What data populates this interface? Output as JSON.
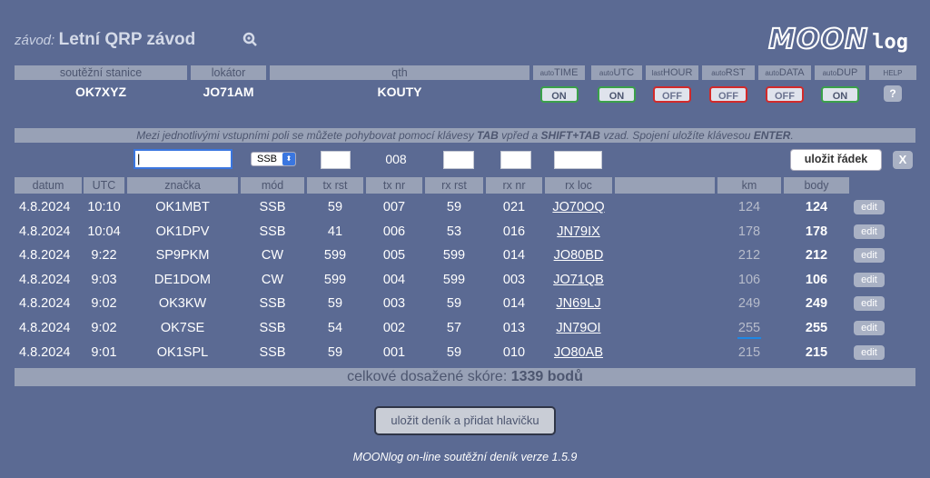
{
  "header": {
    "label": "závod:",
    "contest_name": "Letní QRP závod",
    "logo_moon": "MOON",
    "logo_log": "log"
  },
  "station": {
    "headers": [
      "soutěžní stanice",
      "lokátor",
      "qth"
    ],
    "callsign": "OK7XYZ",
    "locator": "JO71AM",
    "qth": "KOUTY"
  },
  "toggles": [
    {
      "prefix": "auto",
      "name": "TIME",
      "state": "ON"
    },
    {
      "prefix": "auto",
      "name": "UTC",
      "state": "ON"
    },
    {
      "prefix": "last",
      "name": "HOUR",
      "state": "OFF"
    },
    {
      "prefix": "auto",
      "name": "RST",
      "state": "OFF"
    },
    {
      "prefix": "auto",
      "name": "DATA",
      "state": "OFF"
    },
    {
      "prefix": "auto",
      "name": "DUP",
      "state": "ON"
    }
  ],
  "help": {
    "header": "HELP",
    "label": "?"
  },
  "instructions": {
    "part1": "Mezi jednotlivými vstupními poli se můžete pohybovat pomocí klávesy ",
    "key1": "TAB",
    "part2": " vpřed a ",
    "key2": "SHIFT+TAB",
    "part3": " vzad. Spojení uložíte klávesou ",
    "key3": "ENTER",
    "part4": "."
  },
  "entry": {
    "mode_selected": "SSB",
    "tx_nr": "008",
    "save_row_label": "uložit řádek",
    "clear_label": "X"
  },
  "table": {
    "columns": [
      "datum",
      "UTC",
      "značka",
      "mód",
      "tx rst",
      "tx nr",
      "rx rst",
      "rx nr",
      "rx loc",
      "",
      "km",
      "body"
    ],
    "edit_label": "edit",
    "rows": [
      {
        "date": "4.8.2024",
        "utc": "10:10",
        "call": "OK1MBT",
        "mode": "SSB",
        "tx_rst": "59",
        "tx_nr": "007",
        "rx_rst": "59",
        "rx_nr": "021",
        "rx_loc": "JO70OQ",
        "km": "124",
        "points": "124"
      },
      {
        "date": "4.8.2024",
        "utc": "10:04",
        "call": "OK1DPV",
        "mode": "SSB",
        "tx_rst": "41",
        "tx_nr": "006",
        "rx_rst": "53",
        "rx_nr": "016",
        "rx_loc": "JN79IX",
        "km": "178",
        "points": "178"
      },
      {
        "date": "4.8.2024",
        "utc": "9:22",
        "call": "SP9PKM",
        "mode": "CW",
        "tx_rst": "599",
        "tx_nr": "005",
        "rx_rst": "599",
        "rx_nr": "014",
        "rx_loc": "JO80BD",
        "km": "212",
        "points": "212"
      },
      {
        "date": "4.8.2024",
        "utc": "9:03",
        "call": "DE1DOM",
        "mode": "CW",
        "tx_rst": "599",
        "tx_nr": "004",
        "rx_rst": "599",
        "rx_nr": "003",
        "rx_loc": "JO71QB",
        "km": "106",
        "points": "106"
      },
      {
        "date": "4.8.2024",
        "utc": "9:02",
        "call": "OK3KW",
        "mode": "SSB",
        "tx_rst": "59",
        "tx_nr": "003",
        "rx_rst": "59",
        "rx_nr": "014",
        "rx_loc": "JN69LJ",
        "km": "249",
        "points": "249"
      },
      {
        "date": "4.8.2024",
        "utc": "9:02",
        "call": "OK7SE",
        "mode": "SSB",
        "tx_rst": "54",
        "tx_nr": "002",
        "rx_rst": "57",
        "rx_nr": "013",
        "rx_loc": "JN79OI",
        "km": "255",
        "points": "255"
      },
      {
        "date": "4.8.2024",
        "utc": "9:01",
        "call": "OK1SPL",
        "mode": "SSB",
        "tx_rst": "59",
        "tx_nr": "001",
        "rx_rst": "59",
        "rx_nr": "010",
        "rx_loc": "JO80AB",
        "km": "215",
        "points": "215"
      }
    ]
  },
  "score": {
    "label": "celkové dosažené skóre: ",
    "value": "1339 bodů"
  },
  "save_log_button": "uložit deník a přidat hlavičku",
  "footer": "MOONlog on-line soutěžní deník verze 1.5.9",
  "colors": {
    "background": "#5b6a93",
    "header_bar": "#98a1b6",
    "on_border": "#3aa04a",
    "off_border": "#d22a2a",
    "focus": "#3a76e0"
  }
}
